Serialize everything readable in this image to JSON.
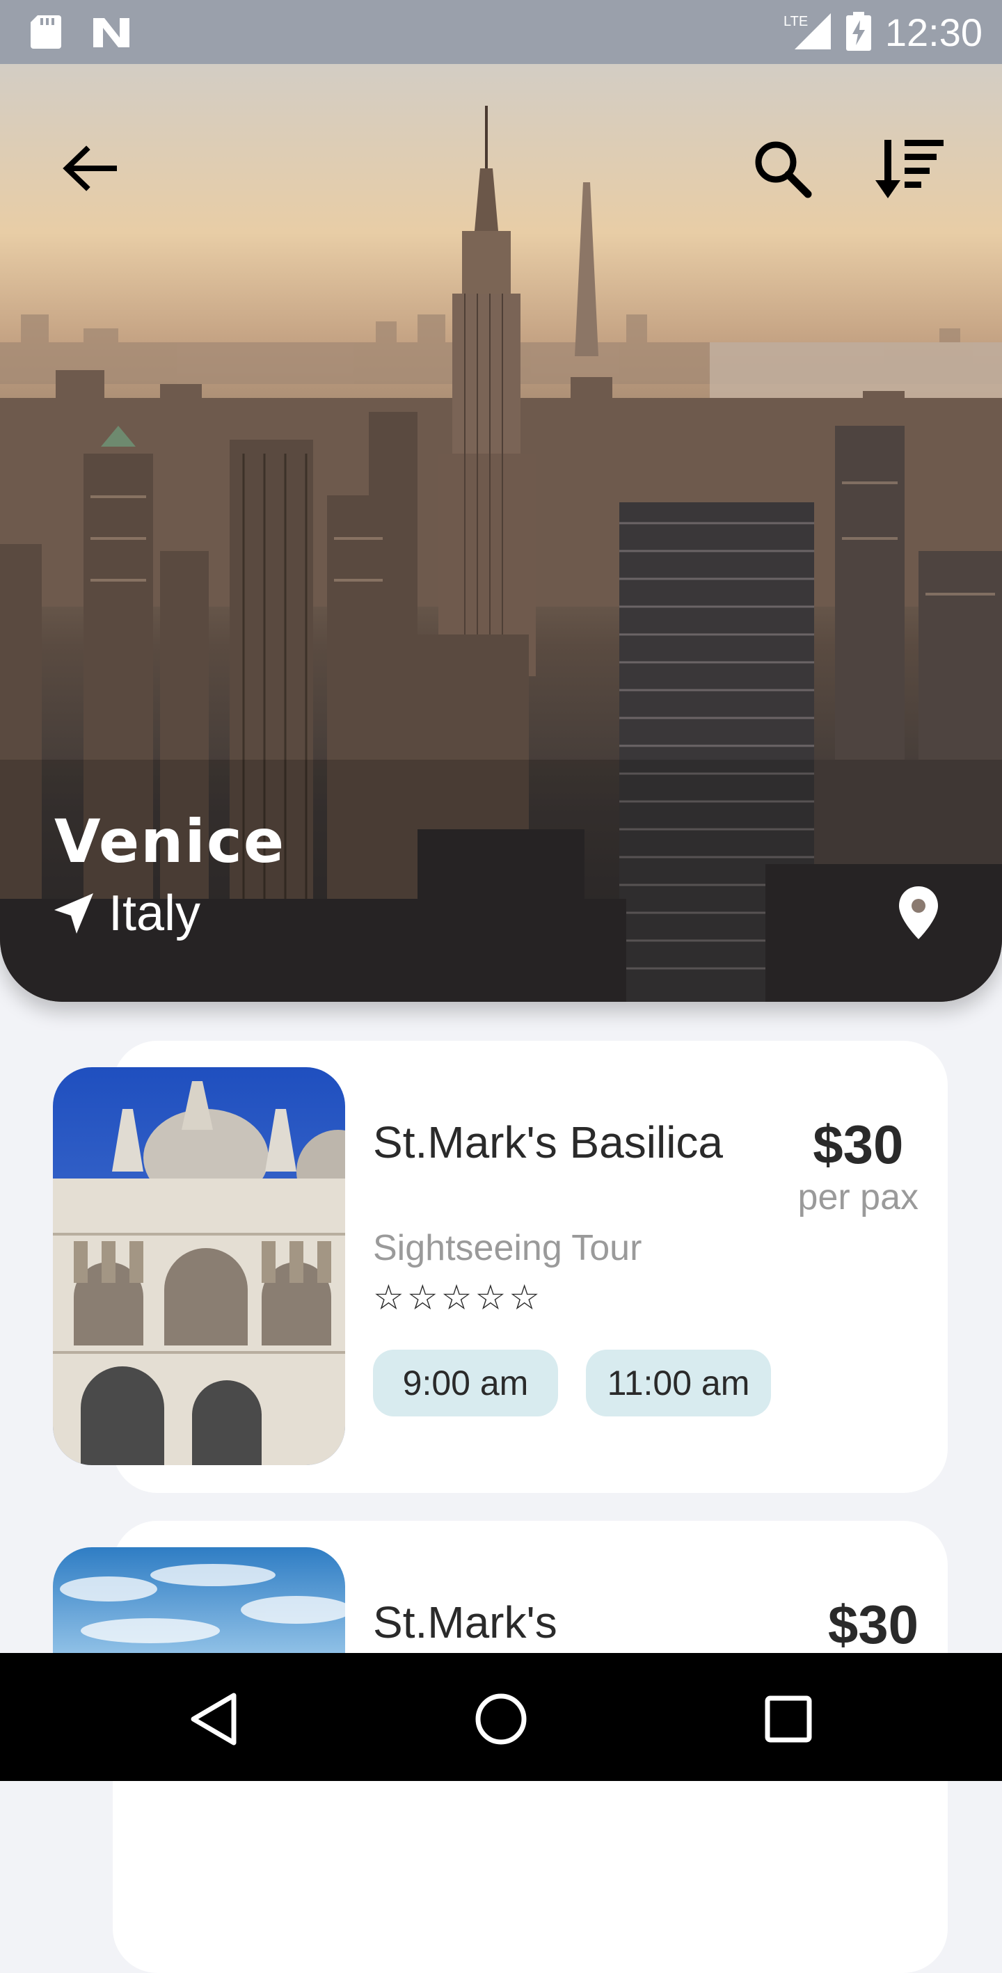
{
  "status_bar": {
    "time": "12:30",
    "network": "LTE",
    "icons": [
      "sd-card-icon",
      "n-notification-icon",
      "lte-signal-icon",
      "battery-charging-icon"
    ]
  },
  "hero": {
    "title": "Venice",
    "country": "Italy",
    "icons": [
      "back-arrow-icon",
      "search-icon",
      "sort-icon",
      "navigation-arrow-icon",
      "location-pin-icon"
    ]
  },
  "tours": [
    {
      "title": "St.Mark's Basilica",
      "category": "Sightseeing Tour",
      "rating_stars": "☆☆☆☆☆",
      "price": "$30",
      "price_unit": "per pax",
      "times": [
        "9:00 am",
        "11:00 am"
      ]
    },
    {
      "title": "St.Mark's",
      "price": "$30"
    }
  ],
  "colors": {
    "background": "#f2f3f7",
    "card": "#ffffff",
    "time_chip": "#d8ebef",
    "primary_text": "#2a2a2a",
    "secondary_text": "#9a9a9a",
    "status_bar": "#9aa0ab",
    "nav_bar": "#000000"
  }
}
